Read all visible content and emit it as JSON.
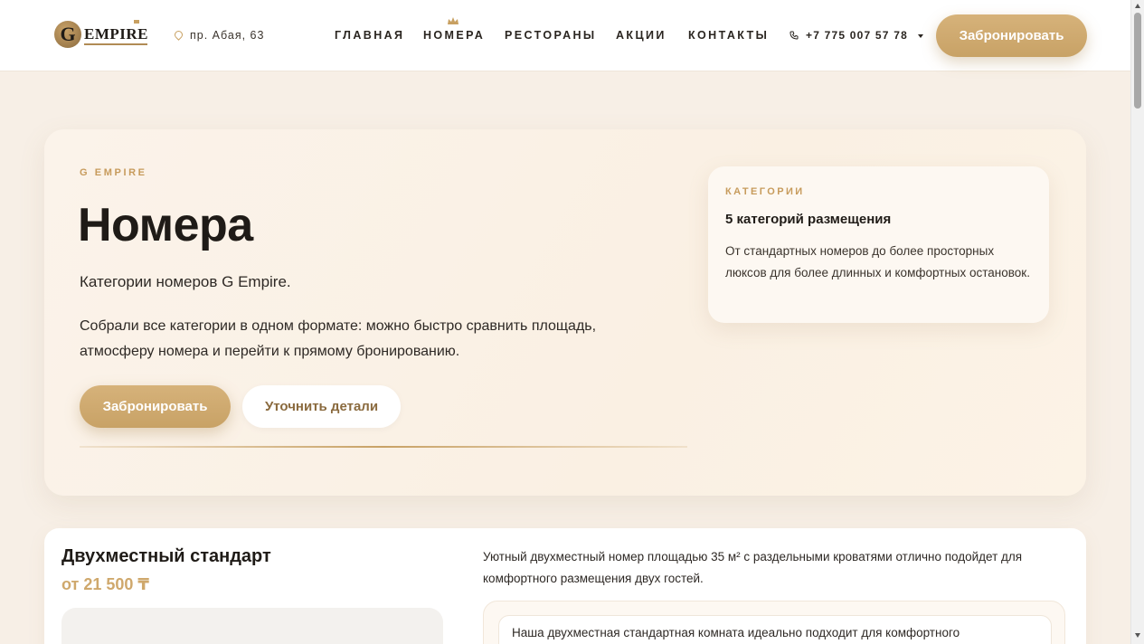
{
  "header": {
    "logo_letter": "G",
    "logo_text": "EMPIRE",
    "address": "пр. Абая, 63",
    "nav": [
      "ГЛАВНАЯ",
      "НОМЕРА",
      "РЕСТОРАНЫ",
      "АКЦИИ",
      "КОНТАКТЫ"
    ],
    "active_nav": "НОМЕРА",
    "phone": "+7 775 007 57 78",
    "book_label": "Забронировать"
  },
  "hero": {
    "eyebrow": "G EMPIRE",
    "title": "Номера",
    "subtitle": "Категории номеров G Empire.",
    "description": "Собрали все категории в одном формате: можно быстро сравнить площадь, атмосферу номера и перейти к прямому бронированию.",
    "book_label": "Забронировать",
    "details_label": "Уточнить детали",
    "info": {
      "eyebrow": "КАТЕГОРИИ",
      "title": "5 категорий размещения",
      "description": "От стандартных номеров до более просторных люксов для более длинных и комфортных остановок."
    }
  },
  "room": {
    "name": "Двухместный стандарт",
    "price": "от 21 500 ₸",
    "description": "Уютный двухместный номер площадью 35 м² с раздельными кроватями отлично подойдет для комфортного размещения двух гостей.",
    "detail_text": "Наша двухместная стандартная комната идеально подходит для комфортного"
  },
  "colors": {
    "accent": "#c8a266",
    "background": "#f7efe6",
    "text": "#1f1b17"
  },
  "icons": {
    "address": "map-pin-icon",
    "phone": "phone-icon",
    "active_nav": "crown-icon"
  }
}
